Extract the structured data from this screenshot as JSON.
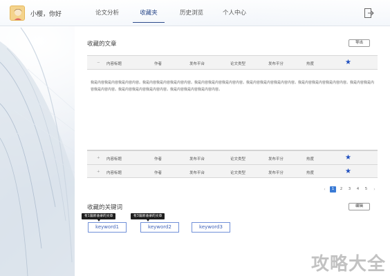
{
  "header": {
    "greeting": "小樱，你好",
    "nav": [
      "论文分析",
      "收藏夹",
      "历史浏览",
      "个人中心"
    ],
    "active_nav": 1
  },
  "articles": {
    "title": "收藏的文章",
    "export_label": "导出",
    "columns": [
      "内容标题",
      "作者",
      "发布平台",
      "论文类型",
      "发布平分",
      "热度"
    ],
    "expanded_text": "我是内容我是内容我是内容内容。我是内容我是内容我是内容内容。我是内容我是内容我是内容内容。我是内容我是内容我是内容内容。我是内容我是内容我是内容内容。我是内容我是内容我是内容内容。我是内容我是内容我是内容内容。我是内容我是内容我是内容内容。",
    "rows": [
      {
        "title": "内容标题",
        "author": "作者",
        "platform": "发布平台",
        "type": "论文类型",
        "score": "发布平分",
        "heat": "热度"
      },
      {
        "title": "内容标题",
        "author": "作者",
        "platform": "发布平台",
        "type": "论文类型",
        "score": "发布平分",
        "heat": "热度"
      }
    ],
    "expand_symbol": "+",
    "collapse_symbol": "−",
    "star_glyph": "★"
  },
  "pagination": {
    "prev": "‹",
    "pages": [
      "1",
      "2",
      "3",
      "4",
      "5"
    ],
    "next": "›",
    "current": "1"
  },
  "keywords": {
    "title": "收藏的关键词",
    "edit_label": "编辑",
    "tips": [
      "有1篇新收录的文章",
      "有3篇新收录的文章"
    ],
    "items": [
      "keyword1",
      "keyword2",
      "keyword3"
    ]
  },
  "watermark": "攻略大全",
  "colors": {
    "accent": "#2b4a8a",
    "star": "#1f4fbf",
    "keyword_border": "#6f8fd8",
    "page_active": "#3a7bd5"
  }
}
